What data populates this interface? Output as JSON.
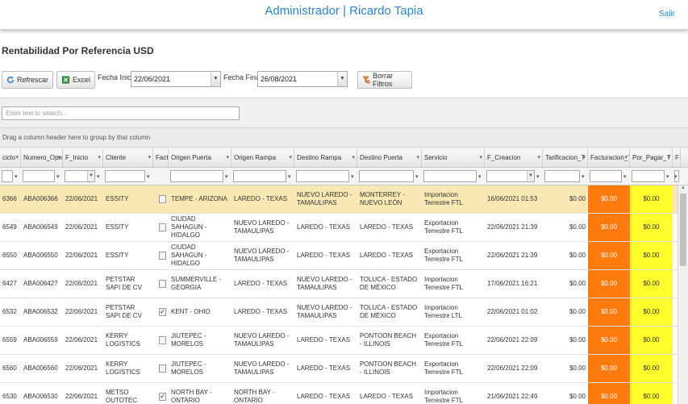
{
  "header": {
    "title": "Administrador |  Ricardo Tapia",
    "logout": "Salir"
  },
  "page": {
    "title": "Rentabilidad Por Referencia USD"
  },
  "toolbar": {
    "refresh": "Refrescar",
    "excel": "Excel",
    "start_label": "Fecha Inicio:",
    "start_value": "22/06/2021",
    "end_label": "Fecha Final:",
    "end_value": "26/08/2021",
    "clear": "Borrar Filtros"
  },
  "grid": {
    "search_placeholder": "Enter text to search...",
    "group_panel": "Drag a column header here to group by that column",
    "columns": [
      "ciclo",
      "Numero_Opera",
      "F_Inicio",
      "Cliente",
      "Factu",
      "Origen Puerta",
      "Origen Rampa",
      "Destino Rampa",
      "Destino Puerta",
      "Servicio",
      "F_Creacion",
      "Tarificacion_T",
      "Facturacion_T",
      "Por_Pagar_T",
      "F"
    ],
    "rows": [
      {
        "ciclo": "6366",
        "numero": "ABA006366",
        "inicio": "22/06/2021",
        "cliente": "ESSITY",
        "checked": false,
        "origen_puerta": "TEMPE - ARIZONA",
        "origen_rampa": "LAREDO - TEXAS",
        "destino_rampa": "NUEVO LAREDO - TAMAULIPAS",
        "destino_puerta": "MONTERREY - NUEVO LEÓN",
        "servicio": "Importacion Terrestre FTL",
        "creacion": "16/06/2021 01:53",
        "tarificacion": "$0.00",
        "facturacion": "$0.00",
        "por_pagar": "$0.00"
      },
      {
        "ciclo": "6549",
        "numero": "ABA006549",
        "inicio": "22/06/2021",
        "cliente": "ESSITY",
        "checked": false,
        "origen_puerta": "CIUDAD SAHAGUN - HIDALGO",
        "origen_rampa": "NUEVO LAREDO - TAMAULIPAS",
        "destino_rampa": "LAREDO - TEXAS",
        "destino_puerta": "LAREDO - TEXAS",
        "servicio": "Exportacion Terrestre FTL",
        "creacion": "22/06/2021 21:39",
        "tarificacion": "$0.00",
        "facturacion": "$0.00",
        "por_pagar": "$0.00"
      },
      {
        "ciclo": "6550",
        "numero": "ABA006550",
        "inicio": "22/06/2021",
        "cliente": "ESSITY",
        "checked": false,
        "origen_puerta": "CIUDAD SAHAGUN - HIDALGO",
        "origen_rampa": "NUEVO LAREDO - TAMAULIPAS",
        "destino_rampa": "LAREDO - TEXAS",
        "destino_puerta": "LAREDO - TEXAS",
        "servicio": "Exportacion Terrestre FTL",
        "creacion": "22/06/2021 21:39",
        "tarificacion": "$0.00",
        "facturacion": "$0.00",
        "por_pagar": "$0.00"
      },
      {
        "ciclo": "6427",
        "numero": "ABA006427",
        "inicio": "22/06/2021",
        "cliente": "PETSTAR SAPI DE CV",
        "checked": false,
        "origen_puerta": "SUMMERVILLE - GEORGIA",
        "origen_rampa": "LAREDO - TEXAS",
        "destino_rampa": "NUEVO LAREDO - TAMAULIPAS",
        "destino_puerta": "TOLUCA - ESTADO DE MÉXICO",
        "servicio": "Importacion Terrestre FTL",
        "creacion": "17/06/2021 16:21",
        "tarificacion": "$0.00",
        "facturacion": "$0.00",
        "por_pagar": "$0.00"
      },
      {
        "ciclo": "6532",
        "numero": "ABA006532",
        "inicio": "22/06/2021",
        "cliente": "PETSTAR SAPI DE CV",
        "checked": true,
        "origen_puerta": "KENT - OHIO",
        "origen_rampa": "LAREDO - TEXAS",
        "destino_rampa": "NUEVO LAREDO - TAMAULIPAS",
        "destino_puerta": "TOLUCA - ESTADO DE MÉXICO",
        "servicio": "Importacion Terrestre LTL",
        "creacion": "22/06/2021 01:02",
        "tarificacion": "$0.00",
        "facturacion": "$0.00",
        "por_pagar": "$0.00"
      },
      {
        "ciclo": "6559",
        "numero": "ABA006559",
        "inicio": "22/06/2021",
        "cliente": "KERRY LOGISTICS",
        "checked": false,
        "origen_puerta": "JIUTEPEC - MORELOS",
        "origen_rampa": "NUEVO LAREDO - TAMAULIPAS",
        "destino_rampa": "LAREDO - TEXAS",
        "destino_puerta": "PONTOON BEACH - ILLINOIS",
        "servicio": "Exportacion Terrestre FTL",
        "creacion": "22/06/2021 22:09",
        "tarificacion": "$0.00",
        "facturacion": "$0.00",
        "por_pagar": "$0.00"
      },
      {
        "ciclo": "6560",
        "numero": "ABA006560",
        "inicio": "22/06/2021",
        "cliente": "KERRY LOGISTICS",
        "checked": false,
        "origen_puerta": "JIUTEPEC - MORELOS",
        "origen_rampa": "NUEVO LAREDO - TAMAULIPAS",
        "destino_rampa": "LAREDO - TEXAS",
        "destino_puerta": "PONTOON BEACH - ILLINOIS",
        "servicio": "Exportacion Terrestre FTL",
        "creacion": "22/06/2021 22:09",
        "tarificacion": "$0.00",
        "facturacion": "$0.00",
        "por_pagar": "$0.00"
      },
      {
        "ciclo": "6530",
        "numero": "ABA006530",
        "inicio": "22/06/2021",
        "cliente": "METSO OUTOTEC",
        "checked": true,
        "origen_puerta": "NORTH BAY - ONTARIO",
        "origen_rampa": "NORTH BAY - ONTARIO",
        "destino_rampa": "LAREDO - TEXAS",
        "destino_puerta": "LAREDO - TEXAS",
        "servicio": "Importacion Terrestre FTL",
        "creacion": "21/06/2021 22:49",
        "tarificacion": "$0.00",
        "facturacion": "$0.00",
        "por_pagar": "$0.00"
      }
    ]
  },
  "colors": {
    "accent": "#2f83c6",
    "facturacion_bg": "#ff7b0e",
    "por_pagar_bg": "#fdfd2e",
    "selected_row": "#f9e8b4"
  }
}
